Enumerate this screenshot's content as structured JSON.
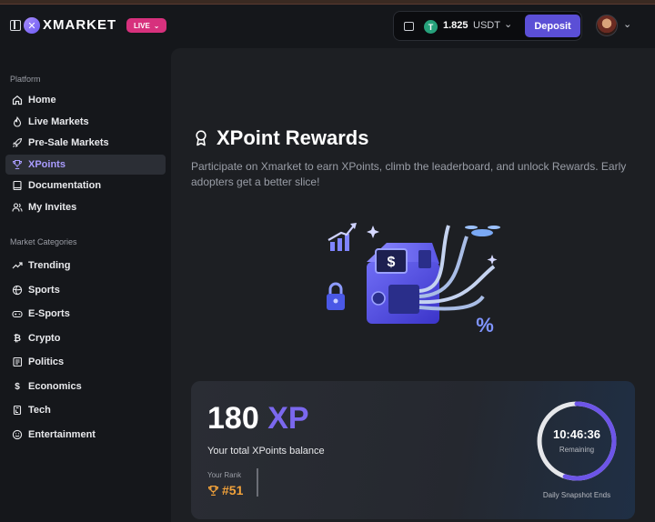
{
  "header": {
    "logo_text": "XMARKET",
    "live_badge": "LIVE",
    "wallet": {
      "balance": "1.825",
      "currency": "USDT",
      "coin_glyph": "T"
    },
    "deposit_label": "Deposit"
  },
  "sidebar": {
    "platform_title": "Platform",
    "platform_items": [
      {
        "label": "Home",
        "icon": "home-icon"
      },
      {
        "label": "Live Markets",
        "icon": "flame-icon"
      },
      {
        "label": "Pre-Sale Markets",
        "icon": "rocket-icon"
      },
      {
        "label": "XPoints",
        "icon": "trophy-icon",
        "active": true
      },
      {
        "label": "Documentation",
        "icon": "book-icon"
      },
      {
        "label": "My Invites",
        "icon": "users-icon"
      }
    ],
    "categories_title": "Market Categories",
    "category_items": [
      {
        "label": "Trending",
        "icon": "trending-icon"
      },
      {
        "label": "Sports",
        "icon": "ball-icon"
      },
      {
        "label": "E-Sports",
        "icon": "gamepad-icon"
      },
      {
        "label": "Crypto",
        "icon": "bitcoin-icon"
      },
      {
        "label": "Politics",
        "icon": "newspaper-icon"
      },
      {
        "label": "Economics",
        "icon": "dollar-icon"
      },
      {
        "label": "Tech",
        "icon": "chip-icon"
      },
      {
        "label": "Entertainment",
        "icon": "smile-icon"
      }
    ]
  },
  "main": {
    "title": "XPoint Rewards",
    "description": "Participate on Xmarket to earn XPoints, climb the leaderboard, and unlock Rewards. Early adopters get a better slice!",
    "card": {
      "xp_value": "180",
      "xp_unit": "XP",
      "balance_label": "Your total XPoints balance",
      "rank_label": "Your Rank",
      "rank_value": "#51",
      "timer": "10:46:36",
      "timer_sub": "Remaining",
      "snapshot_label": "Daily Snapshot Ends",
      "snapshot_progress": 0.55
    }
  },
  "colors": {
    "accent": "#7b68ee",
    "deposit": "#5b4fd6",
    "live": "#d7317d",
    "rank": "#f2a23a",
    "usdt": "#26a17b"
  }
}
